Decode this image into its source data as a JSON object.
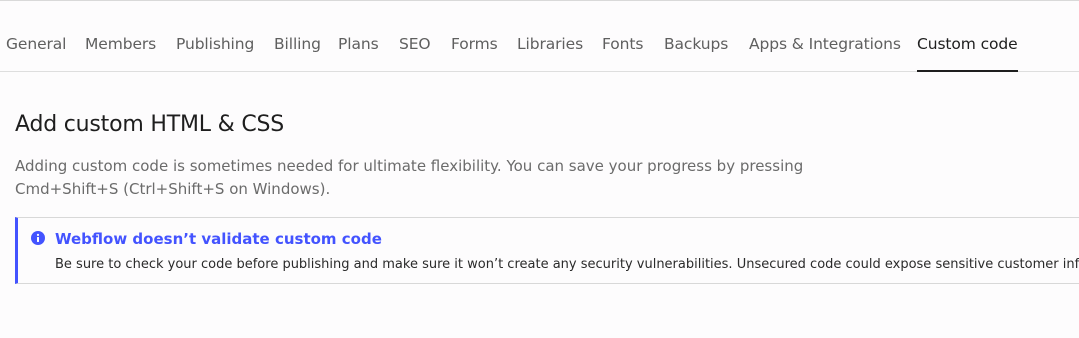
{
  "tabs": [
    {
      "label": "General"
    },
    {
      "label": "Members"
    },
    {
      "label": "Publishing"
    },
    {
      "label": "Billing"
    },
    {
      "label": "Plans"
    },
    {
      "label": "SEO"
    },
    {
      "label": "Forms"
    },
    {
      "label": "Libraries"
    },
    {
      "label": "Fonts"
    },
    {
      "label": "Backups"
    },
    {
      "label": "Apps & Integrations"
    },
    {
      "label": "Custom code"
    }
  ],
  "active_tab": "Custom code",
  "section": {
    "title": "Add custom HTML & CSS",
    "description_line1": "Adding custom code is sometimes needed for ultimate flexibility. You can save your progress by pressing",
    "description_line2": "Cmd+Shift+S (Ctrl+Shift+S on Windows)."
  },
  "notice": {
    "icon": "info-icon",
    "title": "Webflow doesn’t validate custom code",
    "body": "Be sure to check your code before publishing and make sure it won’t create any security vulnerabilities. Unsecured code could expose sensitive customer info"
  },
  "colors": {
    "accent": "#4353ff",
    "text": "#1e1e1e",
    "muted": "#6b6b6b"
  }
}
